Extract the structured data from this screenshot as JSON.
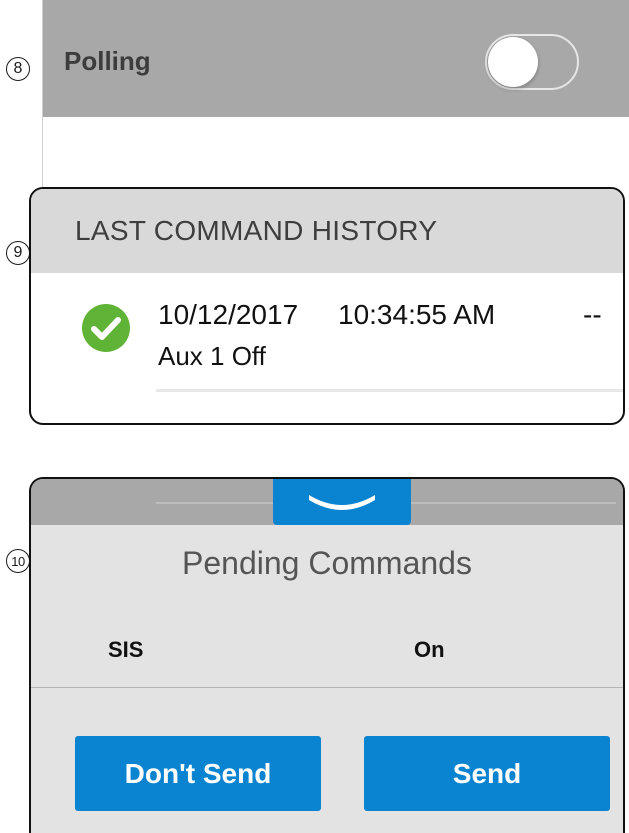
{
  "markers": {
    "step8": "8",
    "step9": "9",
    "step10": "10"
  },
  "polling": {
    "label": "Polling",
    "enabled": false
  },
  "history": {
    "title": "LAST COMMAND HISTORY",
    "entry": {
      "date": "10/12/2017",
      "time": "10:34:55 AM",
      "extra": "--",
      "command": "Aux 1 Off",
      "status_icon": "check-circle-icon"
    }
  },
  "pending": {
    "title": "Pending Commands",
    "item": {
      "name": "SIS",
      "value": "On"
    },
    "dont_send_label": "Don't Send",
    "send_label": "Send",
    "collapse_icon": "chevron-down-icon"
  },
  "colors": {
    "accent_blue": "#0a83d1",
    "success_green": "#5fb336",
    "header_gray": "#a8a8a8",
    "section_gray": "#d9d9d9"
  }
}
